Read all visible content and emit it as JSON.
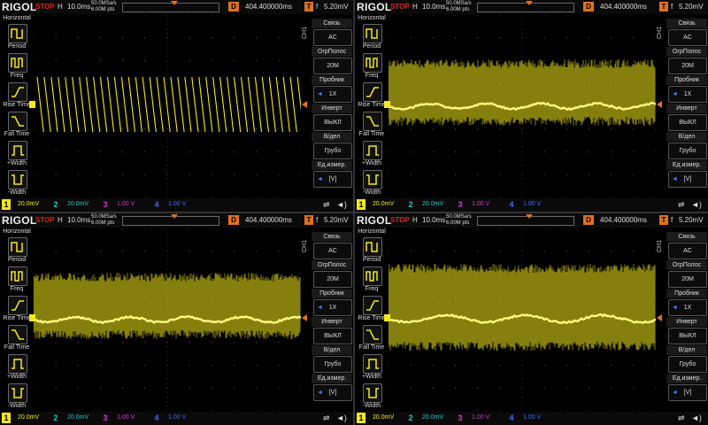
{
  "colors": {
    "ch1": "#f2ea1a",
    "ch2": "#1fc9c9",
    "ch3": "#d03cd0",
    "ch4": "#3a6cff",
    "trigger": "#e07020",
    "stop": "#e02020",
    "bg": "#000000"
  },
  "scope": {
    "brand": "RIGOL",
    "status": "STOP",
    "h_label": "H",
    "timebase": "10.0ms",
    "sample_rate": "50.0MSa/s",
    "memory_depth": "6.00M pts",
    "delay_label": "D",
    "delay": "404.400000ms",
    "trig_label": "T",
    "trig_edge": "f",
    "trig_level": "5.20mV"
  },
  "left_menu": {
    "title": "Horizontal",
    "buttons": [
      {
        "label": "Period",
        "icon": "period-icon"
      },
      {
        "label": "Freq",
        "icon": "freq-icon"
      },
      {
        "label": "Rise Time",
        "icon": "rise-time-icon"
      },
      {
        "label": "Fall Time",
        "icon": "fall-time-icon"
      },
      {
        "label": "+Width",
        "icon": "pos-width-icon"
      },
      {
        "label": "-Width",
        "icon": "neg-width-icon"
      }
    ]
  },
  "right_menu": {
    "channel": "CH1",
    "items": [
      {
        "label": "Связь",
        "value": "AC",
        "arrow": false
      },
      {
        "label": "ОгрПолос",
        "value": "20M",
        "arrow": false
      },
      {
        "label": "Пробник",
        "value": "1X",
        "arrow": true
      },
      {
        "label": "Инверт",
        "value": "ВЫКЛ",
        "arrow": false
      },
      {
        "label": "В/дел",
        "value": "Грубо",
        "arrow": false
      },
      {
        "label": "Ед.измер.",
        "value": "[V]",
        "arrow": true
      }
    ]
  },
  "channels": [
    {
      "num": "1",
      "scale": "20.0mV",
      "coupling": "~"
    },
    {
      "num": "2",
      "scale": "20.0mV",
      "coupling": "~"
    },
    {
      "num": "3",
      "scale": "1.00 V",
      "coupling": ""
    },
    {
      "num": "4",
      "scale": "1.00 V",
      "coupling": ""
    }
  ],
  "panels": [
    {
      "id": "top-left",
      "waveform": "sawtooth"
    },
    {
      "id": "top-right",
      "waveform": "noisy-band"
    },
    {
      "id": "bottom-left",
      "waveform": "noisy-band"
    },
    {
      "id": "bottom-right",
      "waveform": "noisy-band-large"
    }
  ]
}
